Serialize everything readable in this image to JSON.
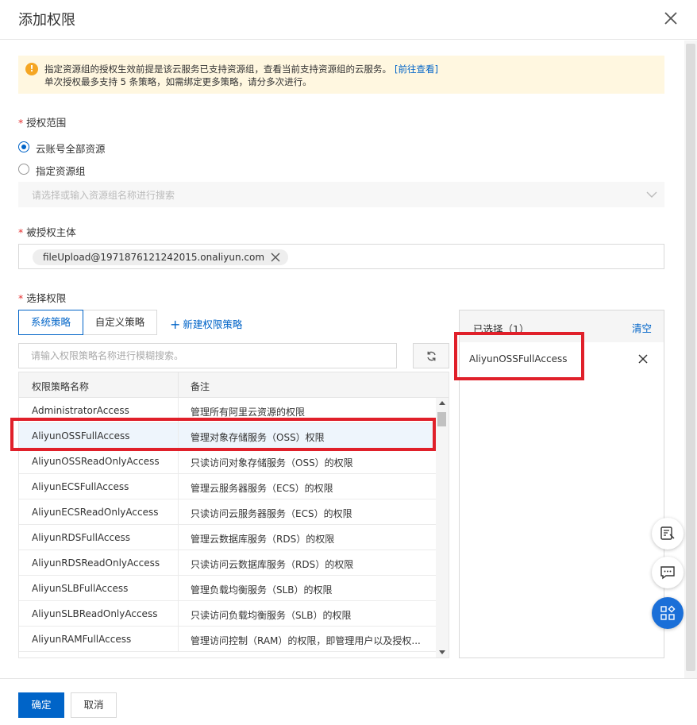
{
  "dialog": {
    "title": "添加权限"
  },
  "notice": {
    "line1": "指定资源组的授权生效前提是该云服务已支持资源组，查看当前支持资源组的云服务。",
    "link": "[前往查看]",
    "line2": "单次授权最多支持 5 条策略，如需绑定更多策略，请分多次进行。"
  },
  "scope": {
    "label": "授权范围",
    "required_mark": "*",
    "option_all": "云账号全部资源",
    "option_group": "指定资源组",
    "selected": "云账号全部资源",
    "group_placeholder": "请选择或输入资源组名称进行搜索"
  },
  "principal": {
    "label": "被授权主体",
    "required_mark": "*",
    "tag": "fileUpload@1971876121242015.onaliyun.com"
  },
  "permissions": {
    "label": "选择权限",
    "required_mark": "*",
    "tabs": [
      "系统策略",
      "自定义策略"
    ],
    "active_tab": "系统策略",
    "new_policy": "新建权限策略",
    "search_placeholder": "请输入权限策略名称进行模糊搜索。",
    "columns": [
      "权限策略名称",
      "备注"
    ],
    "rows": [
      {
        "name": "AdministratorAccess",
        "note": "管理所有阿里云资源的权限"
      },
      {
        "name": "AliyunOSSFullAccess",
        "note": "管理对象存储服务（OSS）权限"
      },
      {
        "name": "AliyunOSSReadOnlyAccess",
        "note": "只读访问对象存储服务（OSS）的权限"
      },
      {
        "name": "AliyunECSFullAccess",
        "note": "管理云服务器服务（ECS）的权限"
      },
      {
        "name": "AliyunECSReadOnlyAccess",
        "note": "只读访问云服务器服务（ECS）的权限"
      },
      {
        "name": "AliyunRDSFullAccess",
        "note": "管理云数据库服务（RDS）的权限"
      },
      {
        "name": "AliyunRDSReadOnlyAccess",
        "note": "只读访问云数据库服务（RDS）的权限"
      },
      {
        "name": "AliyunSLBFullAccess",
        "note": "管理负载均衡服务（SLB）的权限"
      },
      {
        "name": "AliyunSLBReadOnlyAccess",
        "note": "只读访问负载均衡服务（SLB）的权限"
      },
      {
        "name": "AliyunRAMFullAccess",
        "note": "管理访问控制（RAM）的权限，即管理用户以及授权..."
      }
    ],
    "selected_row": "AliyunOSSFullAccess"
  },
  "selected_panel": {
    "title": "已选择（1）",
    "clear": "清空",
    "items": [
      "AliyunOSSFullAccess"
    ]
  },
  "footer": {
    "ok": "确定",
    "cancel": "取消"
  },
  "colors": {
    "primary": "#0064c8",
    "highlight": "#e0202a",
    "notice_bg": "#fff7e0",
    "warn": "#f5a623"
  },
  "icons": {
    "close": "close-icon",
    "warning": "warning-icon",
    "chevron": "chevron-down-icon",
    "tag_remove": "tag-remove-icon",
    "plus": "plus-icon",
    "refresh": "refresh-icon",
    "item_remove": "remove-icon",
    "float_1": "feedback-icon",
    "float_2": "chat-icon",
    "float_3": "apps-icon"
  }
}
